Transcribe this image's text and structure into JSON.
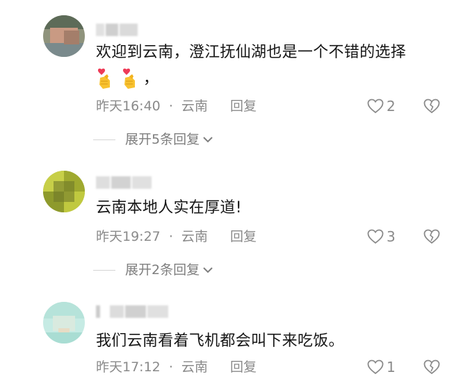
{
  "comments": [
    {
      "text": "欢迎到云南，澄江抚仙湖也是一个不错的选择",
      "text2": "，",
      "time": "昨天16:40",
      "sep": "·",
      "location": "云南",
      "reply_label": "回复",
      "likes": "2",
      "expand_label": "展开5条回复",
      "avatar_color": "#7f8a6e"
    },
    {
      "text": "云南本地人实在厚道!",
      "time": "昨天19:27",
      "sep": "·",
      "location": "云南",
      "reply_label": "回复",
      "likes": "3",
      "expand_label": "展开2条回复",
      "avatar_color": "#b8c23a"
    },
    {
      "text": "我们云南看着飞机都会叫下来吃饭。",
      "time": "昨天17:12",
      "sep": "·",
      "location": "云南",
      "reply_label": "回复",
      "likes": "1",
      "avatar_color": "#bfe7df"
    }
  ],
  "icons": {
    "heart": "heart-icon",
    "dislike": "broken-heart-icon",
    "chevron": "chevron-down-icon",
    "emoji": "finger-heart-emoji"
  },
  "colors": {
    "text": "#161616",
    "meta": "#8a8a8a"
  }
}
